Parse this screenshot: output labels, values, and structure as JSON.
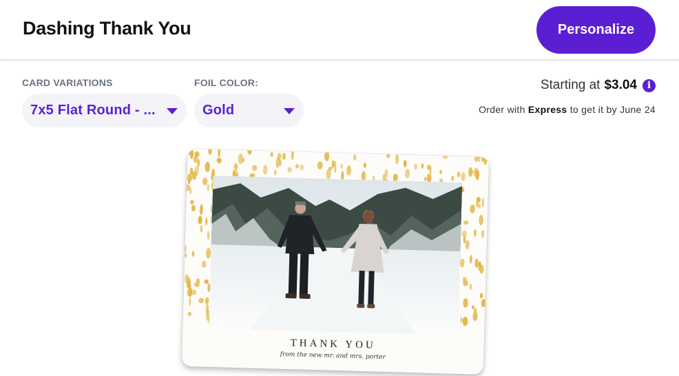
{
  "header": {
    "title": "Dashing Thank You",
    "personalize_label": "Personalize"
  },
  "options": {
    "card_variations": {
      "label": "CARD VARIATIONS",
      "value": "7x5 Flat Round - ..."
    },
    "foil_color": {
      "label": "FOIL COLOR:",
      "value": "Gold"
    }
  },
  "pricing": {
    "prefix": "Starting at",
    "amount": "$3.04",
    "info_icon": "info-icon",
    "express_before": "Order with",
    "express_word": "Express",
    "express_after": "to get it by June 24"
  },
  "card": {
    "headline": "THANK YOU",
    "signature": "from the new mr. and mrs. porter"
  },
  "colors": {
    "accent": "#5b1fd3",
    "foil": "#e2b64a",
    "select_bg": "#f3f3f8"
  }
}
